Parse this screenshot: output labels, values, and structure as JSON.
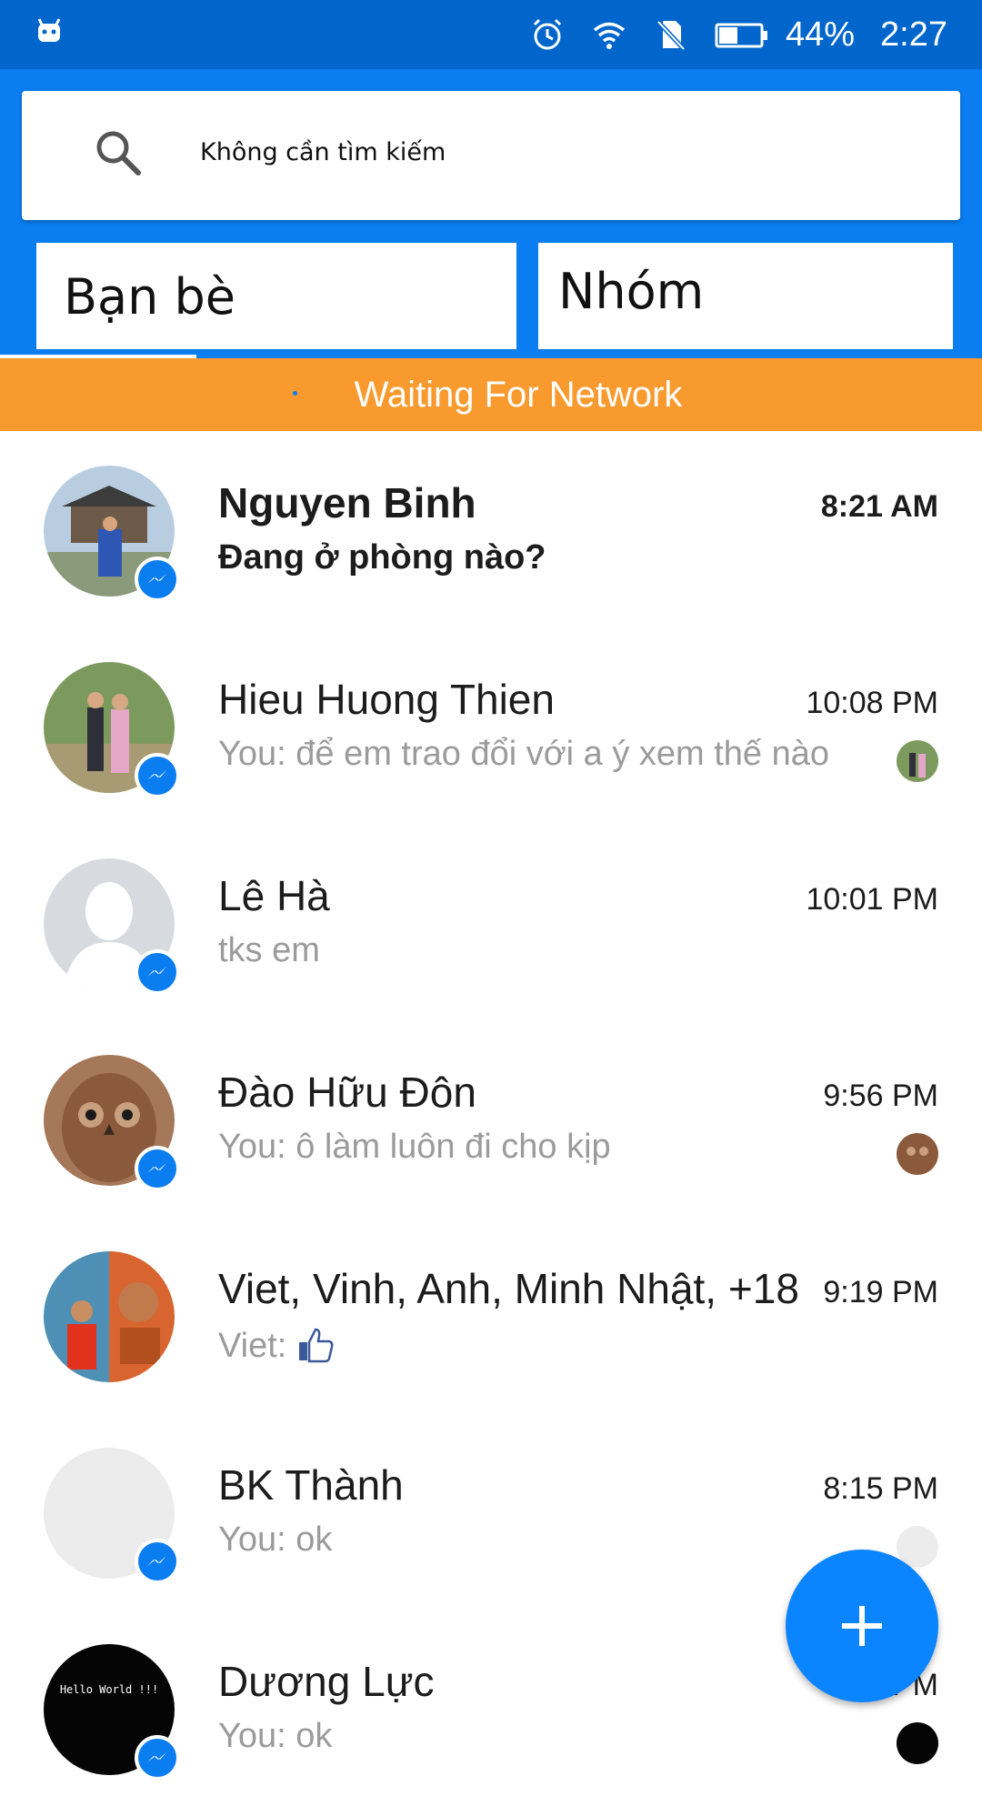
{
  "status_bar": {
    "left_icon": "android-debug-icon",
    "icons": [
      "alarm-icon",
      "wifi-icon",
      "no-sim-icon",
      "battery-icon"
    ],
    "battery_percent": "44%",
    "time": "2:27"
  },
  "search": {
    "icon": "search-icon",
    "placeholder": "Không cần tìm kiếm"
  },
  "tabs": [
    {
      "label": "Bạn bè",
      "active": true
    },
    {
      "label": "Nhóm",
      "active": false
    }
  ],
  "network_banner": {
    "text": "Waiting For Network"
  },
  "conversations": [
    {
      "name": "Nguyen Binh",
      "time": "8:21 AM",
      "snippet": "Đang ở phòng nào?",
      "unread": true,
      "avatar": "pagoda-photo",
      "messenger_badge": true
    },
    {
      "name": "Hieu Huong Thien",
      "time": "10:08 PM",
      "snippet": "You: để em trao đổi với a ý xem thế nào",
      "unread": false,
      "avatar": "couple-photo",
      "messenger_badge": true,
      "seen_avatar": true
    },
    {
      "name": "Lê Hà",
      "time": "10:01 PM",
      "snippet": "tks em",
      "unread": false,
      "avatar": "default-silhouette",
      "messenger_badge": true
    },
    {
      "name": "Đào Hữu Đôn",
      "time": "9:56 PM",
      "snippet": "You: ô làm luôn đi cho kịp",
      "unread": false,
      "avatar": "owl-photo",
      "messenger_badge": true,
      "seen_avatar": true
    },
    {
      "name": "Viet, Vinh, Anh, Minh Nhật, +18",
      "time": "9:19 PM",
      "snippet": "Viet:",
      "snippet_icon": "thumbs-up-icon",
      "unread": false,
      "avatar": "group-photo",
      "messenger_badge": false
    },
    {
      "name": "BK Thành",
      "time": "8:15 PM",
      "snippet": "You: ok",
      "unread": false,
      "avatar": "blank-gray",
      "messenger_badge": true,
      "seen_avatar": true
    },
    {
      "name": "Dương Lực",
      "time": "PM",
      "snippet": "You: ok",
      "unread": false,
      "avatar": "hello-world-dark",
      "avatar_text": "Hello World !!!",
      "messenger_badge": true,
      "seen_avatar": true
    }
  ],
  "fab": {
    "icon": "plus-icon"
  },
  "colors": {
    "status_bar": "#0066cc",
    "header": "#0a7df0",
    "banner": "#f99a2e",
    "fab": "#0a84ff",
    "secondary_text": "#9b9b9b"
  }
}
